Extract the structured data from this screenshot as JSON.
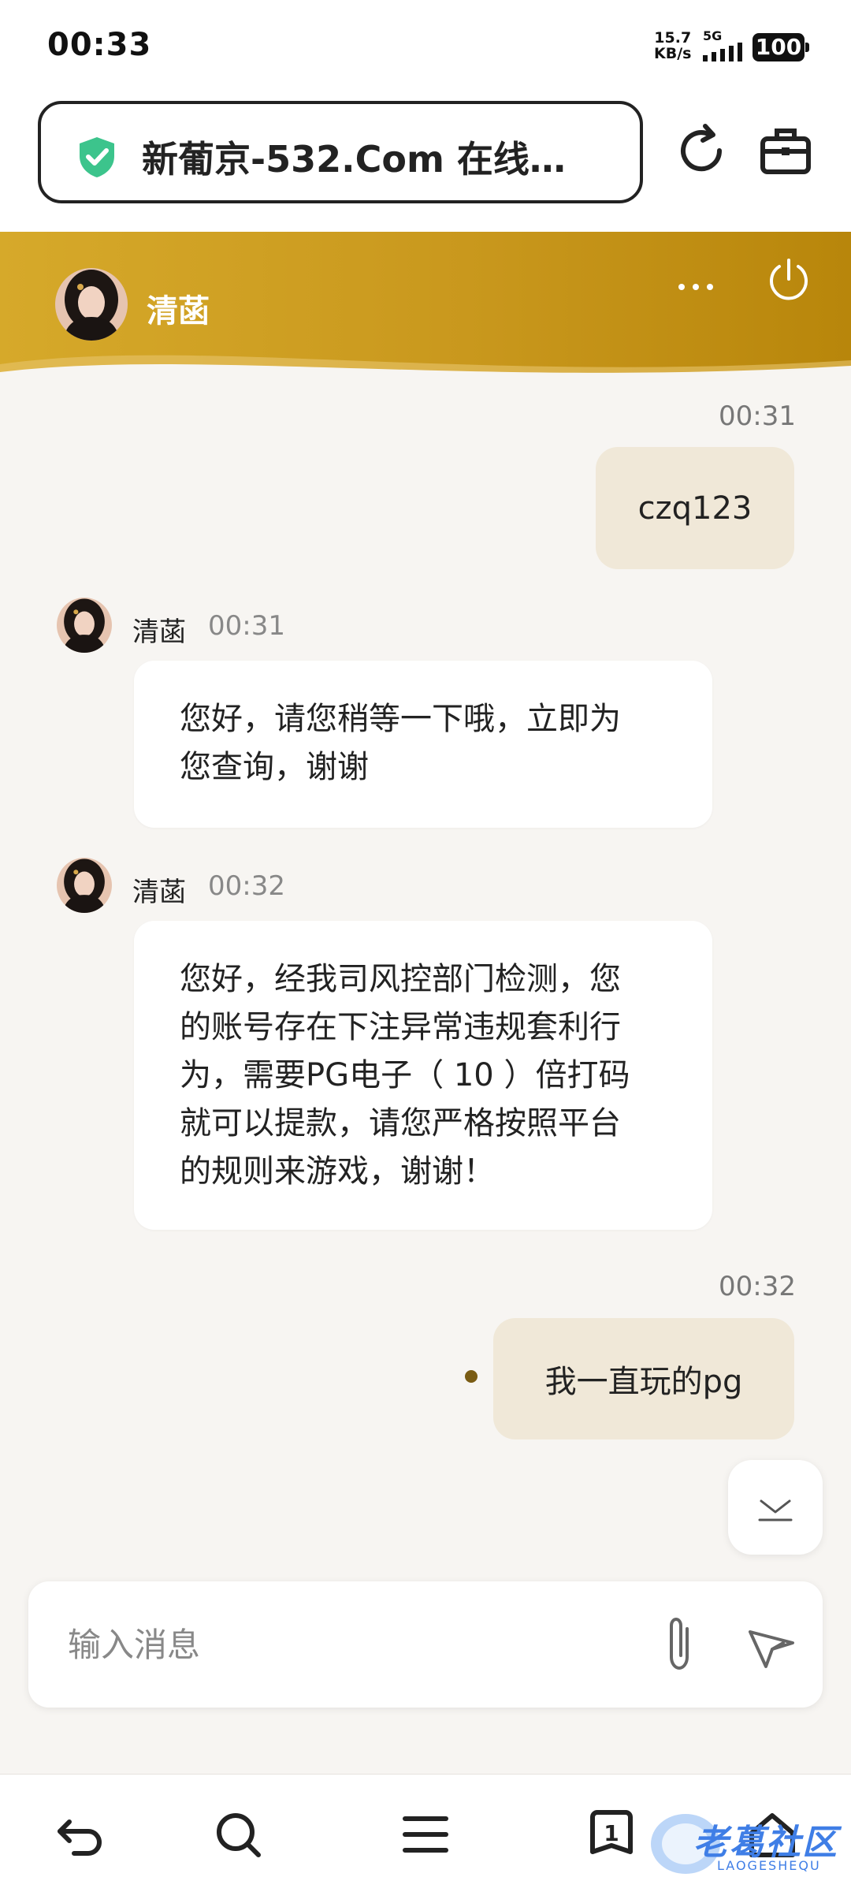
{
  "status_bar": {
    "time": "00:33",
    "net_speed_value": "15.7",
    "net_speed_unit": "KB/s",
    "network_type": "5G",
    "battery": "100"
  },
  "browser": {
    "url_title": "新葡京-532.Com 在线…",
    "secure_color": "#3cc48c"
  },
  "chat": {
    "agent_name": "清菡",
    "header_color": "#c9981d",
    "messages": [
      {
        "from": "user",
        "time": "00:31",
        "text": "czq123"
      },
      {
        "from": "agent",
        "name": "清菡",
        "time": "00:31",
        "lines": [
          "您好，请您稍等一下哦，立即为",
          "您查询，谢谢"
        ]
      },
      {
        "from": "agent",
        "name": "清菡",
        "time": "00:32",
        "lines": [
          "您好，经我司风控部门检测，您",
          "的账号存在下注异常违规套利行",
          "为，需要PG电子（ 10 ）倍打码",
          "就可以提款，请您严格按照平台",
          "的规则来游戏，谢谢！"
        ]
      },
      {
        "from": "user",
        "time": "00:32",
        "text": "我一直玩的pg"
      }
    ]
  },
  "input": {
    "placeholder": "输入消息"
  },
  "bottom_nav": {
    "tab_count": "1",
    "watermark": "老葛社区",
    "watermark_sub": "LAOGESHEQU"
  }
}
